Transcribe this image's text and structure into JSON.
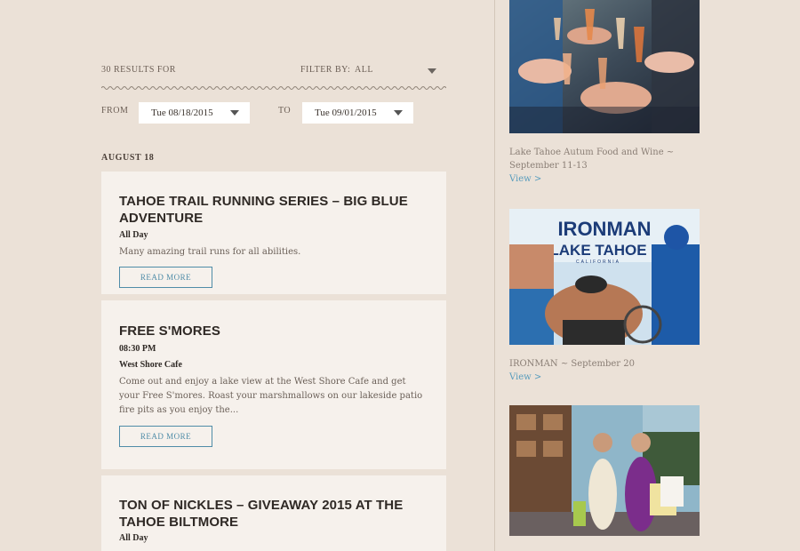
{
  "filters": {
    "results_label": "30 RESULTS FOR",
    "filter_by_label": "FILTER BY:",
    "filter_value": "ALL",
    "from_label": "FROM",
    "from_date": "Tue 08/18/2015",
    "to_label": "TO",
    "to_date": "Tue 09/01/2015"
  },
  "day_heading": "AUGUST 18",
  "events": [
    {
      "title": "TAHOE TRAIL RUNNING SERIES – BIG BLUE ADVENTURE",
      "time": "All Day",
      "venue": "",
      "description": "Many amazing trail runs for all abilities.",
      "button": "READ MORE"
    },
    {
      "title": "FREE S'MORES",
      "time": "08:30 PM",
      "venue": "West Shore Cafe",
      "description": "Come out and enjoy a lake view at the West Shore Cafe and get your Free S'mores. Roast your marshmallows on our lakeside patio fire pits as you enjoy the...",
      "button": "READ MORE"
    },
    {
      "title": "TON OF NICKLES – GIVEAWAY 2015 AT THE TAHOE BILTMORE",
      "time": "All Day",
      "venue": "",
      "description": "",
      "button": ""
    }
  ],
  "promos": [
    {
      "caption": "Lake Tahoe Autum Food and Wine ~ September 11-13",
      "link": "View >"
    },
    {
      "caption": "IRONMAN ~ September 20",
      "link": "View >",
      "logo_main": "IRONMAN",
      "logo_sub": "LAKE TAHOE",
      "logo_small": "CALIFORNIA"
    },
    {
      "caption": "",
      "link": ""
    }
  ],
  "colors": {
    "background": "#ebe1d7",
    "card": "#f6f1ec",
    "accent": "#4f8ca8",
    "link": "#5a9dbd"
  }
}
